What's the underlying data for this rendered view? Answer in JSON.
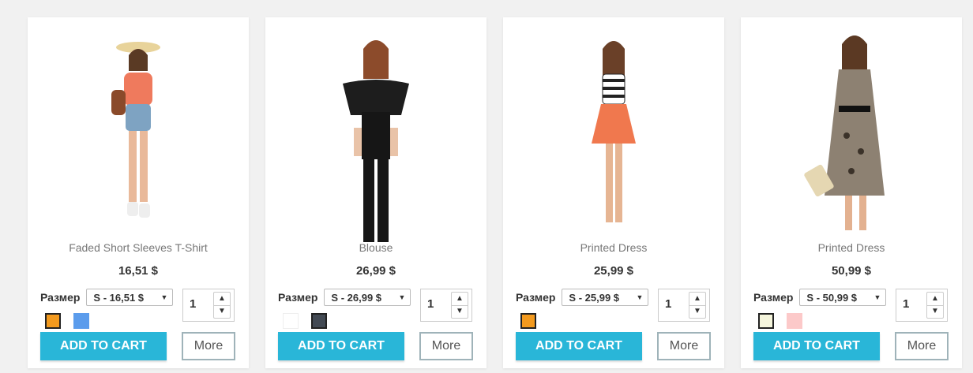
{
  "labels": {
    "size": "Размер",
    "add_to_cart": "ADD TO CART",
    "more": "More"
  },
  "products": [
    {
      "name": "Faded Short Sleeves T-Shirt",
      "price": "16,51 $",
      "size_option": "S - 16,51 $",
      "quantity": "1",
      "colors": [
        "#f39a1e",
        "#5b9cec"
      ]
    },
    {
      "name": "Blouse",
      "price": "26,99 $",
      "size_option": "S - 26,99 $",
      "quantity": "1",
      "colors": [
        "#ffffff",
        "#434a54"
      ]
    },
    {
      "name": "Printed Dress",
      "price": "25,99 $",
      "size_option": "S - 25,99 $",
      "quantity": "1",
      "colors": [
        "#f39a1e"
      ]
    },
    {
      "name": "Printed Dress",
      "price": "50,99 $",
      "size_option": "S - 50,99 $",
      "quantity": "1",
      "colors": [
        "#f5f5dc",
        "#fcc9c9"
      ]
    }
  ]
}
